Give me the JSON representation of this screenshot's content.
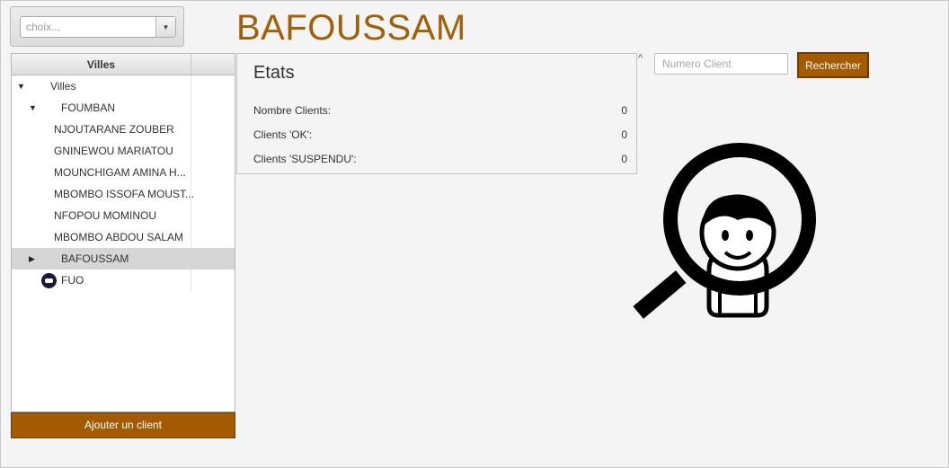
{
  "city_select": {
    "placeholder": "choix..."
  },
  "page_title": "BAFOUSSAM",
  "tree": {
    "header": "Villes",
    "rows": [
      {
        "label": "Villes",
        "toggle": "▼"
      },
      {
        "label": "FOUMBAN",
        "toggle": "▼"
      },
      {
        "label": "NJOUTARANE ZOUBER"
      },
      {
        "label": "GNINEWOU MARIATOU"
      },
      {
        "label": "MOUNCHIGAM AMINA H..."
      },
      {
        "label": "MBOMBO ISSOFA MOUST..."
      },
      {
        "label": "NFOPOU MOMINOU"
      },
      {
        "label": "MBOMBO ABDOU SALAM"
      },
      {
        "label": "BAFOUSSAM",
        "toggle": "▶"
      },
      {
        "label": "FUO"
      }
    ]
  },
  "add_client_label": "Ajouter un client",
  "etats": {
    "title": "Etats",
    "rows": [
      {
        "label": "Nombre Clients:",
        "value": "0"
      },
      {
        "label": "Clients 'OK':",
        "value": "0"
      },
      {
        "label": "Clients 'SUSPENDU':",
        "value": "0"
      }
    ]
  },
  "caret": "^",
  "search": {
    "placeholder": "Numero Client",
    "button_label": "Rechercher"
  },
  "colors": {
    "accent": "#a35a00",
    "title": "#a0600a"
  },
  "icons": {
    "illustration": "search-person-icon",
    "fuo": "location-icon"
  }
}
